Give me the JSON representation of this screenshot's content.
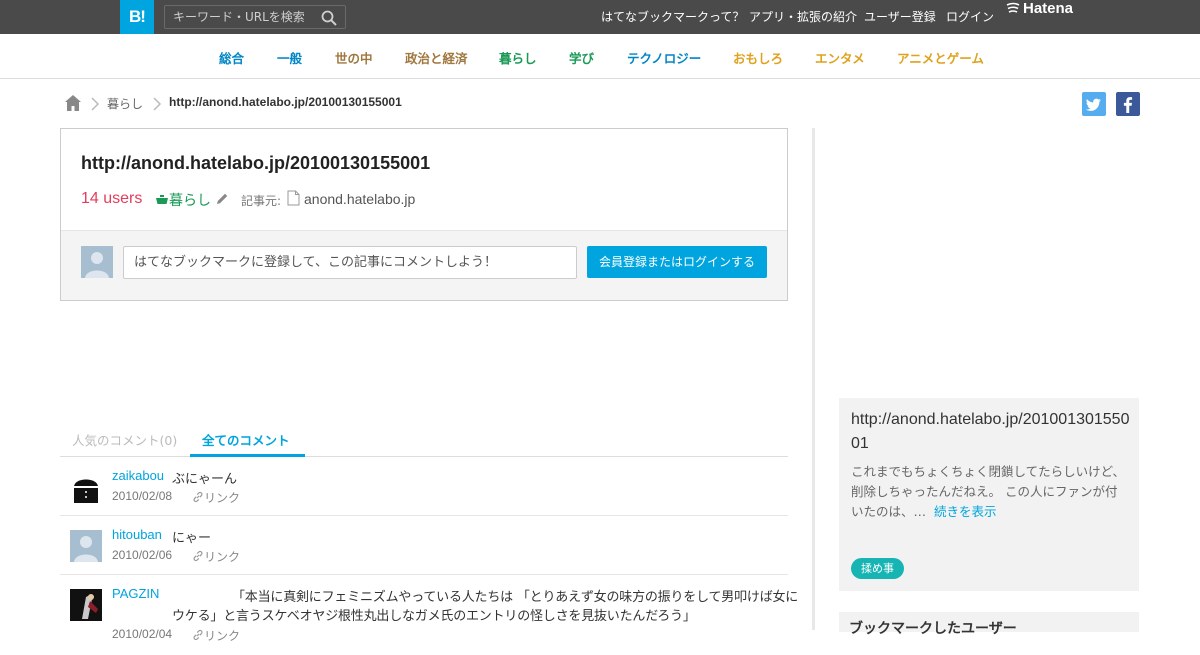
{
  "topbar": {
    "logo": "B!",
    "search_placeholder": "キーワード・URLを検索",
    "links": [
      "はてなブックマークって？",
      "アプリ・拡張の紹介",
      "ユーザー登録",
      "ログイン"
    ],
    "brand": "Hatena"
  },
  "categories": [
    {
      "label": "総合",
      "color": "#0086c6"
    },
    {
      "label": "一般",
      "color": "#0086c6"
    },
    {
      "label": "世の中",
      "color": "#a0773f"
    },
    {
      "label": "政治と経済",
      "color": "#a0773f"
    },
    {
      "label": "暮らし",
      "color": "#1a9a56"
    },
    {
      "label": "学び",
      "color": "#1a9a56"
    },
    {
      "label": "テクノロジー",
      "color": "#0086c6"
    },
    {
      "label": "おもしろ",
      "color": "#e0a21c"
    },
    {
      "label": "エンタメ",
      "color": "#e0a21c"
    },
    {
      "label": "アニメとゲーム",
      "color": "#e0a21c"
    }
  ],
  "breadcrumb": {
    "category": "暮らし",
    "current": "http://anond.hatelabo.jp/20100130155001"
  },
  "entry": {
    "title": "http://anond.hatelabo.jp/20100130155001",
    "users": "14 users",
    "category": "暮らし",
    "source_label": "記事元:",
    "source": "anond.hatelabo.jp",
    "comment_placeholder": "はてなブックマークに登録して、この記事にコメントしよう！",
    "login_button": "会員登録またはログインする"
  },
  "tabs": {
    "popular": "人気のコメント",
    "popular_count": "(0)",
    "all": "全てのコメント"
  },
  "comments": [
    {
      "user": "zaikabou",
      "text": "ぶにゃーん",
      "date": "2010/02/08",
      "link": "リンク"
    },
    {
      "user": "hitouban",
      "text": "にゃー",
      "date": "2010/02/06",
      "link": "リンク"
    },
    {
      "user": "PAGZIN",
      "text_line1": "「本当に真剣にフェミニズムやっている人たちは 「とりあえず女の味方の振りをして男叩けば女に",
      "text_line2": "ウケる」と言うスケベオヤジ根性丸出しなガメ氏のエントリの怪しさを見抜いたんだろう」",
      "date": "2010/02/04",
      "link": "リンク"
    }
  ],
  "sidebar": {
    "title": "http://anond.hatelabo.jp/20100130155001",
    "description": "これまでもちょくちょく閉鎖してたらしいけど、削除しちゃったんだねえ。 この人にファンが付いたのは、…",
    "more": "続きを表示",
    "tag": "揉め事",
    "bookmarked_users_heading": "ブックマークしたユーザー"
  },
  "colors": {
    "accent": "#00a4de",
    "topbar": "#4a4a4a",
    "users": "#e33d5c",
    "kurashi": "#1a9a56"
  }
}
